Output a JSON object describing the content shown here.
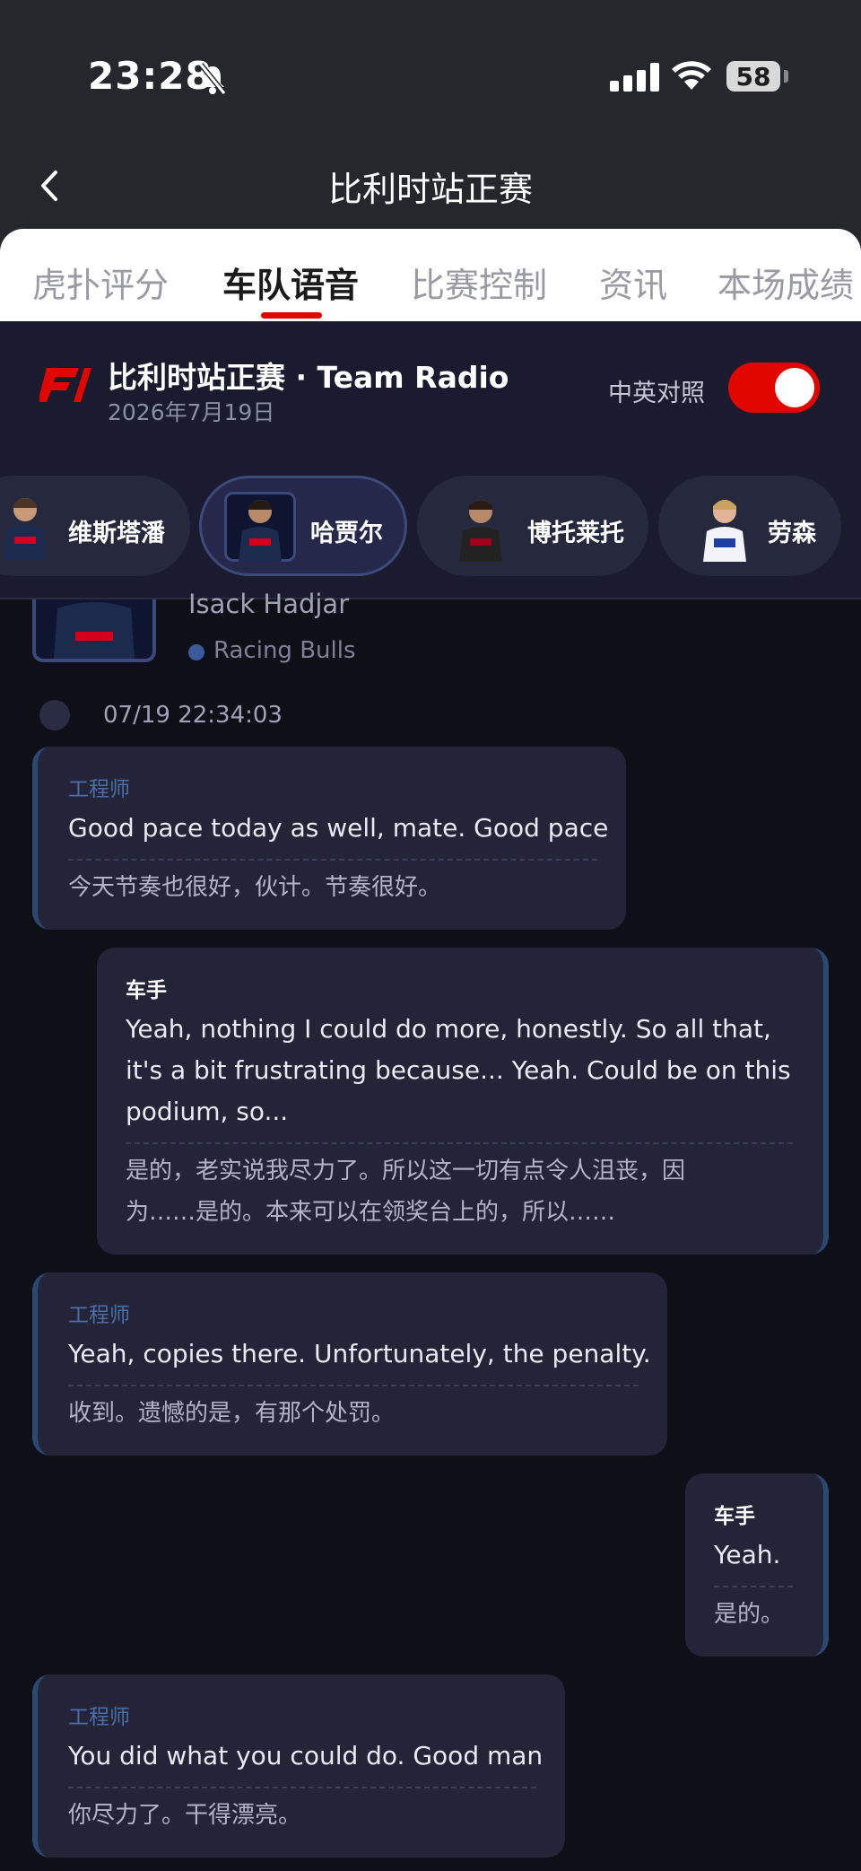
{
  "status_bar": {
    "time": "23:28",
    "battery": "58"
  },
  "nav": {
    "title": "比利时站正赛"
  },
  "tabs": [
    {
      "label": "虎扑评分"
    },
    {
      "label": "车队语音"
    },
    {
      "label": "比赛控制"
    },
    {
      "label": "资讯"
    },
    {
      "label": "本场成绩"
    }
  ],
  "header": {
    "logo": "F1",
    "title": "比利时站正赛 · Team Radio",
    "date": "2026年7月19日",
    "compare_label": "中英对照",
    "compare_on": true
  },
  "drivers": [
    {
      "name": "维斯塔潘"
    },
    {
      "name": "哈贾尔"
    },
    {
      "name": "博托莱托"
    },
    {
      "name": "劳森"
    }
  ],
  "profile": {
    "name": "Isack Hadjar",
    "team": "Racing Bulls"
  },
  "timestamp": "07/19 22:34:03",
  "messages": [
    {
      "speaker": "工程师",
      "role": "engineer",
      "en": "Good pace today as well, mate. Good pace",
      "zh": "今天节奏也很好，伙计。节奏很好。"
    },
    {
      "speaker": "车手",
      "role": "driver",
      "en_lines": [
        "Yeah, nothing I could do more, honestly. So all that,",
        "it's a bit frustrating because... Yeah. Could be on this",
        "podium, so..."
      ],
      "zh_lines": [
        "是的，老实说我尽力了。所以这一切有点令人沮丧，因",
        "为……是的。本来可以在领奖台上的，所以……"
      ]
    },
    {
      "speaker": "工程师",
      "role": "engineer",
      "en": "Yeah, copies there. Unfortunately, the penalty.",
      "zh": "收到。遗憾的是，有那个处罚。"
    },
    {
      "speaker": "车手",
      "role": "driver",
      "en": "Yeah.",
      "zh": "是的。"
    },
    {
      "speaker": "工程师",
      "role": "engineer",
      "en": "You did what you could do. Good man",
      "zh": "你尽力了。干得漂亮。"
    }
  ],
  "colors": {
    "accent": "#e10600",
    "background": "#0f0f18",
    "bubble": "#232438"
  }
}
